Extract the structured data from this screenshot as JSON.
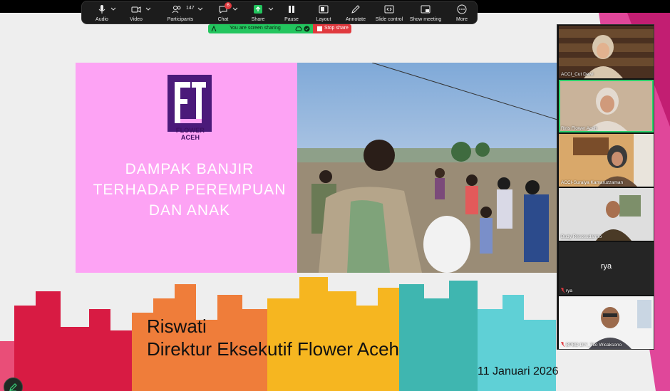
{
  "toolbar": {
    "audio": "Audio",
    "video": "Video",
    "participants": "Participants",
    "participants_count": "147",
    "chat": "Chat",
    "chat_badge": "6",
    "share": "Share",
    "pause": "Pause",
    "layout": "Layout",
    "annotate": "Annotate",
    "slide_control": "Slide control",
    "show_meeting": "Show meeting",
    "more": "More"
  },
  "share_bar": {
    "status": "You are screen sharing",
    "stop": "Stop share"
  },
  "slide": {
    "logo_text": "FLOWER ACEH",
    "title_lines": [
      "DAMPAK BANJIR",
      "TERHADAP PEREMPUAN",
      "DAN ANAK"
    ],
    "speaker_name": "Riswati",
    "speaker_role": "Direktur Eksekutif Flower Aceh",
    "date": "11 Januari 2026"
  },
  "participants": [
    {
      "name": "ACCI_Cut Dewi",
      "muted": false,
      "active": false,
      "video": true
    },
    {
      "name": "Riris Flower Aceh",
      "muted": false,
      "active": true,
      "video": true
    },
    {
      "name": "ACCI-Suraiya Kamaruzzaman",
      "muted": false,
      "active": false,
      "video": true
    },
    {
      "name": "Budy Resosudarmo",
      "muted": false,
      "active": false,
      "video": true
    },
    {
      "name": "rya",
      "center_label": "rya",
      "muted": true,
      "active": false,
      "video": false
    },
    {
      "name": "BPBD DIY_Tito Wicaksono",
      "muted": true,
      "active": false,
      "video": true
    }
  ],
  "colors": {
    "slide_panel": "#fda3f4",
    "share_green": "#23c55e",
    "stop_red": "#e0393e",
    "active_speaker": "#2cd16b"
  }
}
